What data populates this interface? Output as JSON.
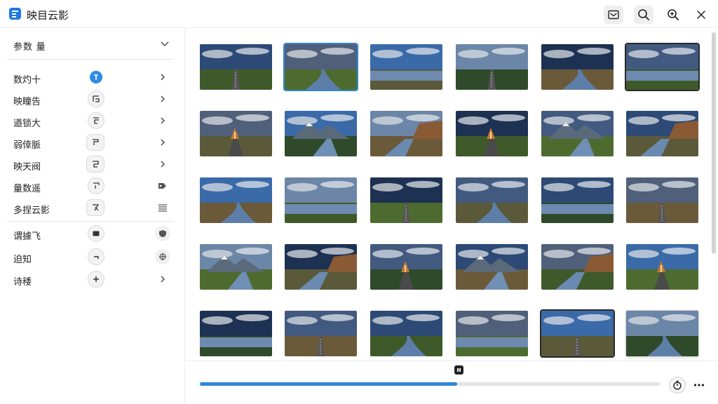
{
  "app": {
    "title": "映目云影",
    "accent": "#2f86d6"
  },
  "toolbar": {
    "icons": [
      "mail-icon",
      "search-icon",
      "zoom-in-icon",
      "close-icon"
    ]
  },
  "sidebar": {
    "header": "参数 量",
    "groups": [
      [
        {
          "label": "数灼十",
          "icon": "pin-icon",
          "right": "chevron-right-icon"
        },
        {
          "label": "映瞳告",
          "icon": "glyph-icon",
          "right": "chevron-right-icon"
        },
        {
          "label": "遒锁大",
          "icon": "glyph-icon",
          "right": "chevron-right-icon"
        },
        {
          "label": "弱倖脈",
          "icon": "glyph-icon",
          "right": "chevron-right-icon"
        },
        {
          "label": "映天阀",
          "icon": "glyph-icon",
          "right": "chevron-right-icon"
        },
        {
          "label": "量数遥",
          "icon": "glyph-icon",
          "right": "tag-icon"
        },
        {
          "label": "多捏云影",
          "icon": "glyph-icon",
          "right": "menu-icon"
        }
      ],
      [
        {
          "label": "谓據飞",
          "icon": "rect-icon",
          "right": "shield-icon"
        },
        {
          "label": "迫知",
          "icon": "minus-icon",
          "right": "crosshair-icon"
        },
        {
          "label": "诗䅗",
          "icon": "plus-icon",
          "right": "chevron-right-icon"
        }
      ]
    ]
  },
  "gallery": {
    "rows": 5,
    "cols": 6,
    "selected_index": 1
  },
  "progress": {
    "value": 0.56
  },
  "bottom": {
    "icons": [
      "timer-icon",
      "more-icon"
    ]
  }
}
